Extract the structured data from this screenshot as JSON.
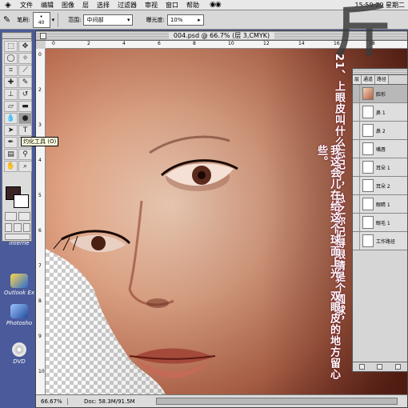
{
  "menubar": {
    "items": [
      "文件",
      "编辑",
      "图像",
      "层",
      "选择",
      "过滤器",
      "审视",
      "窗口",
      "帮助"
    ],
    "clock": "15:59:29 星期二"
  },
  "options_bar": {
    "brush_label": "笔刷:",
    "brush_size": "40",
    "range_label": "范围:",
    "range_value": "中间部",
    "exposure_label": "曝光度:",
    "exposure_value": "10%"
  },
  "toolbox": {
    "tooltip": "灼化工具 (O)"
  },
  "desktop_icons": [
    "Interne",
    "Outlook Ex",
    "Photosho",
    "DVD"
  ],
  "document": {
    "title": "004.psd @ 66.7% (层 3,CMYK)",
    "zoom": "66.67%",
    "doc_size": "Doc: 58.3M/91.5M",
    "ruler_top": [
      "0",
      "2",
      "4",
      "6",
      "8",
      "10",
      "12",
      "14",
      "16",
      "18"
    ],
    "ruler_left": [
      "0",
      "2",
      "3",
      "4",
      "5",
      "6",
      "7",
      "8",
      "9",
      "10"
    ],
    "overlay_text": {
      "line1": "21、上眼皮叫什么忘记了，总之你记得眼睛是个圆球，",
      "line2": "我这会儿在给这个球面上光，双眼皮的地方留心些。"
    }
  },
  "layers_palette": {
    "tabs": [
      "层",
      "通道",
      "路径"
    ],
    "layers": [
      "脸形",
      "鼻 1",
      "鼻 2",
      "嘴唇",
      "耳朵 1",
      "耳朵 2",
      "眼睛 1",
      "眼毛 1",
      "工作路径"
    ]
  },
  "big_char": "斤"
}
